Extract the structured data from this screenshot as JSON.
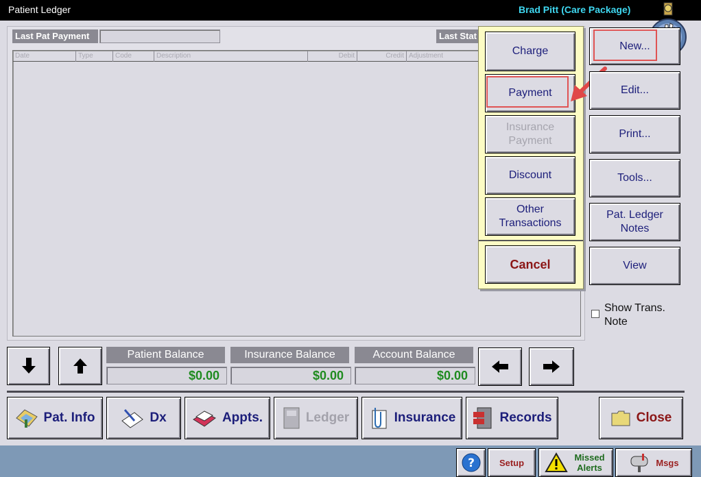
{
  "window": {
    "title": "Patient Ledger",
    "user": "Brad Pitt (Care Package)"
  },
  "fields": {
    "last_pat_payment": "Last Pat Payment",
    "last_stat": "Last Stat"
  },
  "columns": [
    "Date",
    "Type",
    "Code",
    "Description",
    "Debit",
    "Credit",
    "Adjustment"
  ],
  "popup_menu": {
    "charge": "Charge",
    "payment": "Payment",
    "insurance_payment": "Insurance Payment",
    "discount": "Discount",
    "other_transactions": "Other Transactions",
    "cancel": "Cancel"
  },
  "right_buttons": {
    "new": "New...",
    "edit": "Edit...",
    "print": "Print...",
    "tools": "Tools...",
    "ledger_notes": "Pat. Ledger Notes",
    "view": "View"
  },
  "show_trans_note": {
    "label": "Show Trans. Note",
    "checked": false
  },
  "balances": {
    "patient": {
      "label": "Patient Balance",
      "value": "$0.00"
    },
    "insurance": {
      "label": "Insurance Balance",
      "value": "$0.00"
    },
    "account": {
      "label": "Account Balance",
      "value": "$0.00"
    }
  },
  "nav": {
    "pat_info": "Pat. Info",
    "dx": "Dx",
    "appts": "Appts.",
    "ledger": "Ledger",
    "insurance": "Insurance",
    "records": "Records",
    "close": "Close"
  },
  "status_bar": {
    "help": "?",
    "setup": "Setup",
    "missed_alerts": "Missed Alerts",
    "msgs": "Msgs"
  },
  "colors": {
    "accent_text": "#1c1e7a",
    "balance_green": "#1f8b1f",
    "cancel_red": "#8b1616",
    "highlight": "#e05353",
    "popup_bg": "#fdfcc4"
  }
}
